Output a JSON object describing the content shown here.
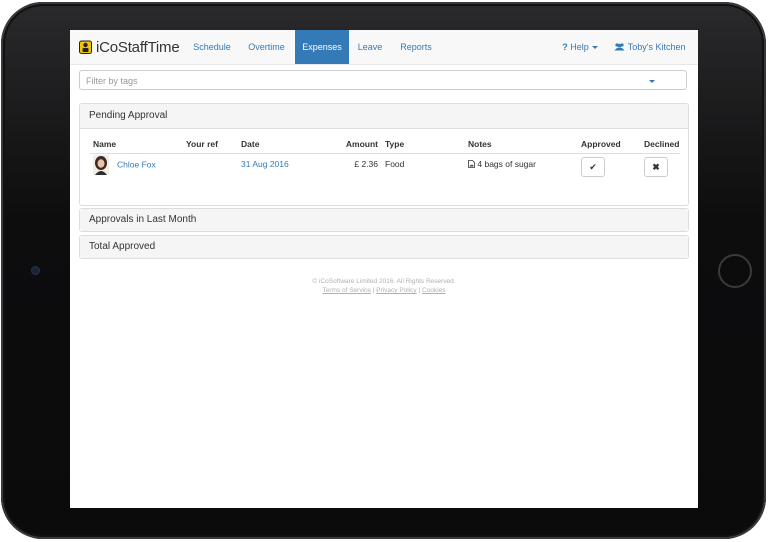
{
  "brand": {
    "name": "iCoStaffTime"
  },
  "nav": {
    "items": [
      {
        "label": "Schedule"
      },
      {
        "label": "Overtime"
      },
      {
        "label": "Expenses"
      },
      {
        "label": "Leave"
      },
      {
        "label": "Reports"
      }
    ],
    "active": "Expenses",
    "help_label": "Help",
    "user_label": "Toby's Kitchen"
  },
  "filter": {
    "placeholder": "Filter by tags",
    "value": ""
  },
  "pending": {
    "title": "Pending Approval",
    "headers": [
      "Name",
      "Your ref",
      "Date",
      "Amount",
      "Type",
      "Notes",
      "Approved",
      "Declined"
    ],
    "rows": [
      {
        "name": "Chloe Fox",
        "ref": "",
        "date": "31 Aug 2016",
        "amount": "£ 2.36",
        "type": "Food",
        "notes": "4 bags of sugar",
        "approve_icon": "check-icon",
        "decline_icon": "times-icon"
      }
    ]
  },
  "approvals_last_month": {
    "title": "Approvals in Last Month"
  },
  "total_approved": {
    "title": "Total Approved"
  },
  "footer": {
    "copyright": "© iCoSoftware Limited 2016. All Rights Reserved.",
    "terms": "Terms of Service",
    "privacy": "Privacy Policy",
    "cookies": "Cookies",
    "separator": "|"
  },
  "colors": {
    "accent": "#337ab7",
    "navbar_bg": "#f8f8f8",
    "panel_heading_bg": "#f5f5f5"
  }
}
